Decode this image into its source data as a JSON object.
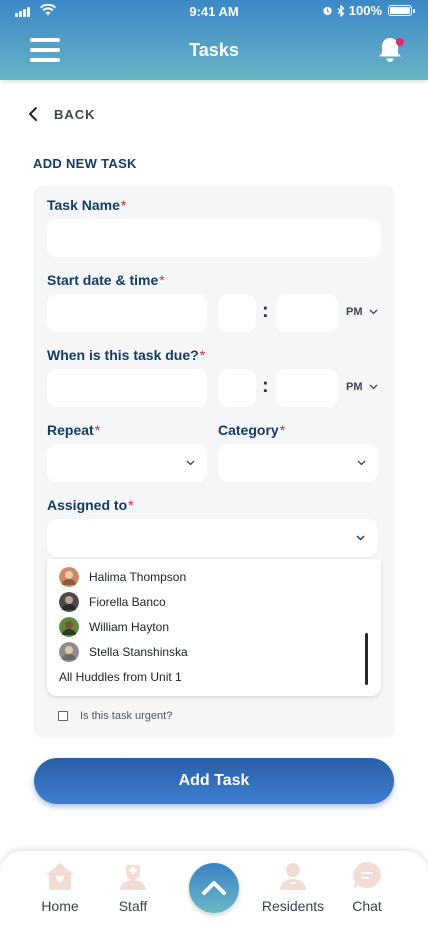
{
  "status_bar": {
    "time": "9:41 AM",
    "battery": "100%"
  },
  "header": {
    "title": "Tasks"
  },
  "back_label": "BACK",
  "section_title": "ADD NEW TASK",
  "form": {
    "task_name_label": "Task Name",
    "start_label": "Start date & time",
    "due_label": "When is this task due?",
    "repeat_label": "Repeat",
    "category_label": "Category",
    "assigned_label": "Assigned to",
    "required_mark": "*",
    "time_separator": ":",
    "start_ampm": "PM",
    "due_ampm": "PM"
  },
  "assignees": [
    {
      "name": "Halima Thompson"
    },
    {
      "name": "Fiorella Banco"
    },
    {
      "name": "William Hayton"
    },
    {
      "name": "Stella Stanshinska"
    },
    {
      "name": "All Huddles from Unit 1"
    }
  ],
  "urgent_label": "Is this task urgent?",
  "add_button": "Add Task",
  "nav": {
    "home": "Home",
    "staff": "Staff",
    "residents": "Residents",
    "chat": "Chat"
  },
  "colors": {
    "header": "#4a97c6",
    "primary_button": "#2f6cbc",
    "accent_dot": "#e6266d",
    "nav_icon": "#f2dcd6"
  },
  "icons": [
    "hamburger-menu-icon",
    "bell-icon",
    "chevron-left-icon",
    "chevron-down-icon",
    "home-icon",
    "staff-icon",
    "chevron-up-icon",
    "residents-icon",
    "chat-icon"
  ]
}
